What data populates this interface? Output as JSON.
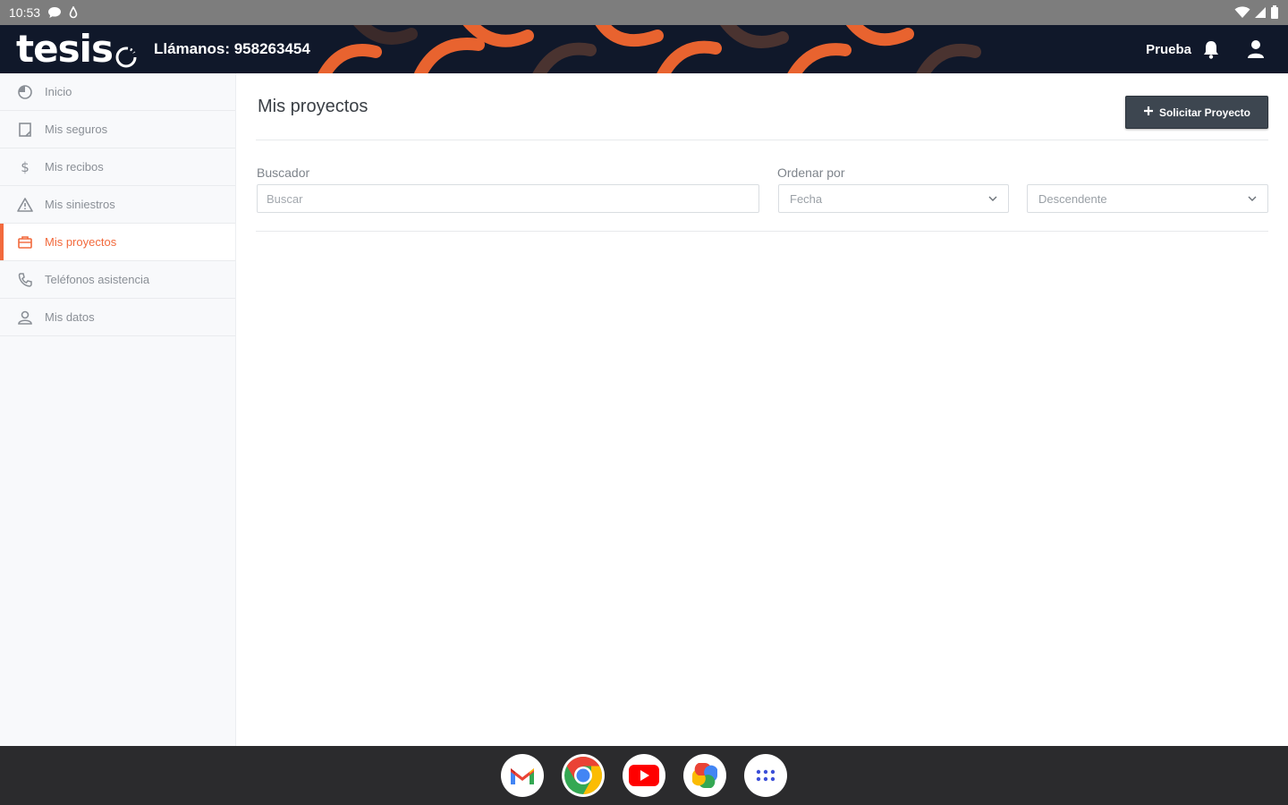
{
  "status_bar": {
    "time": "10:53",
    "icons": [
      "chat-icon",
      "drop-icon",
      "wifi-icon",
      "signal-icon",
      "battery-icon"
    ]
  },
  "header": {
    "logo_text": "tesis",
    "phone": "Llámanos: 958263454",
    "user_name": "Prueba",
    "icons": [
      "bell-icon",
      "user-icon"
    ],
    "colors": {
      "background": "#10182a",
      "pattern": "#e8632f"
    }
  },
  "sidebar": {
    "items": [
      {
        "label": "Inicio",
        "icon": "home-icon",
        "active": false
      },
      {
        "label": "Mis seguros",
        "icon": "document-icon",
        "active": false
      },
      {
        "label": "Mis recibos",
        "icon": "dollar-icon",
        "active": false
      },
      {
        "label": "Mis siniestros",
        "icon": "warning-icon",
        "active": false
      },
      {
        "label": "Mis proyectos",
        "icon": "briefcase-icon",
        "active": true
      },
      {
        "label": "Teléfonos asistencia",
        "icon": "phone-icon",
        "active": false
      },
      {
        "label": "Mis datos",
        "icon": "user-icon",
        "active": false
      }
    ],
    "accent_color": "#f26a3d"
  },
  "main": {
    "title": "Mis proyectos",
    "request_button_label": "Solicitar Proyecto",
    "search": {
      "label": "Buscador",
      "placeholder": "Buscar",
      "value": ""
    },
    "order": {
      "label": "Ordenar por",
      "field_value": "Fecha",
      "direction_value": "Descendente"
    }
  },
  "taskbar": {
    "apps": [
      "gmail-icon",
      "chrome-icon",
      "youtube-icon",
      "photos-icon",
      "app-drawer-icon"
    ]
  }
}
